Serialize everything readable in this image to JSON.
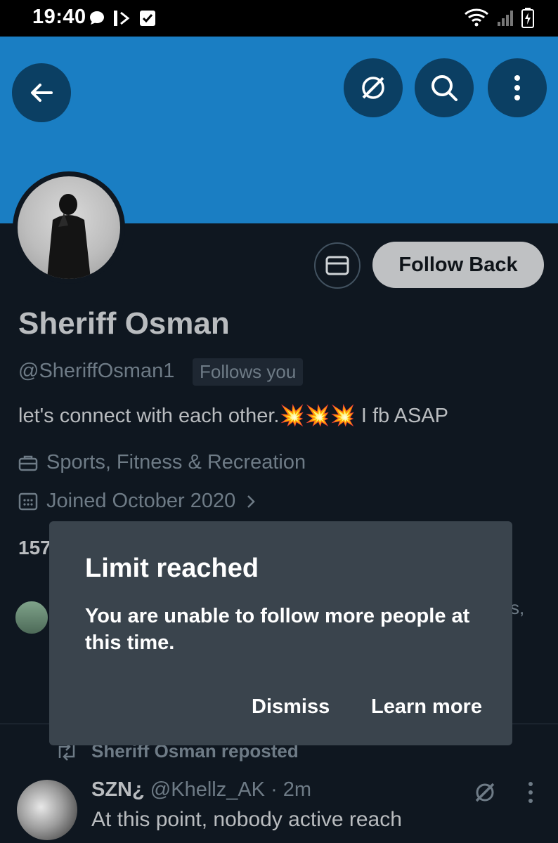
{
  "status_bar": {
    "time": "19:40",
    "icons": [
      "chat-bubble-icon",
      "bt-icon",
      "checkbox-icon",
      "wifi-icon",
      "signal-icon",
      "battery-icon"
    ]
  },
  "header": {
    "back_icon": "arrow-left-icon",
    "grok_icon": "grok-icon",
    "search_icon": "search-icon",
    "more_icon": "more-vertical-icon"
  },
  "profile": {
    "name": "Sheriff Osman",
    "handle": "@SheriffOsman1",
    "follows_you": "Follows you",
    "bio": "let's connect with each other.",
    "bio_emoji": "💥💥💥",
    "bio_suffix": " I fb ASAP",
    "category": "Sports, Fitness & Recreation",
    "joined": "Joined October 2020",
    "following_fragment": "157",
    "followed_by_fragment": "s,"
  },
  "actions": {
    "follow_back": "Follow Back"
  },
  "dialog": {
    "title": "Limit reached",
    "body": "You are unable to follow more people at this time.",
    "dismiss": "Dismiss",
    "learn_more": "Learn more"
  },
  "timeline": {
    "repost_label": "Sheriff Osman reposted",
    "tweet": {
      "name": "SZN¿",
      "handle": "@Khellz_AK",
      "time": "· 2m",
      "text": "At this point, nobody active reach"
    }
  },
  "colors": {
    "banner": "#1a7ec3",
    "background": "#0f1720",
    "dialog": "#3a444d"
  }
}
